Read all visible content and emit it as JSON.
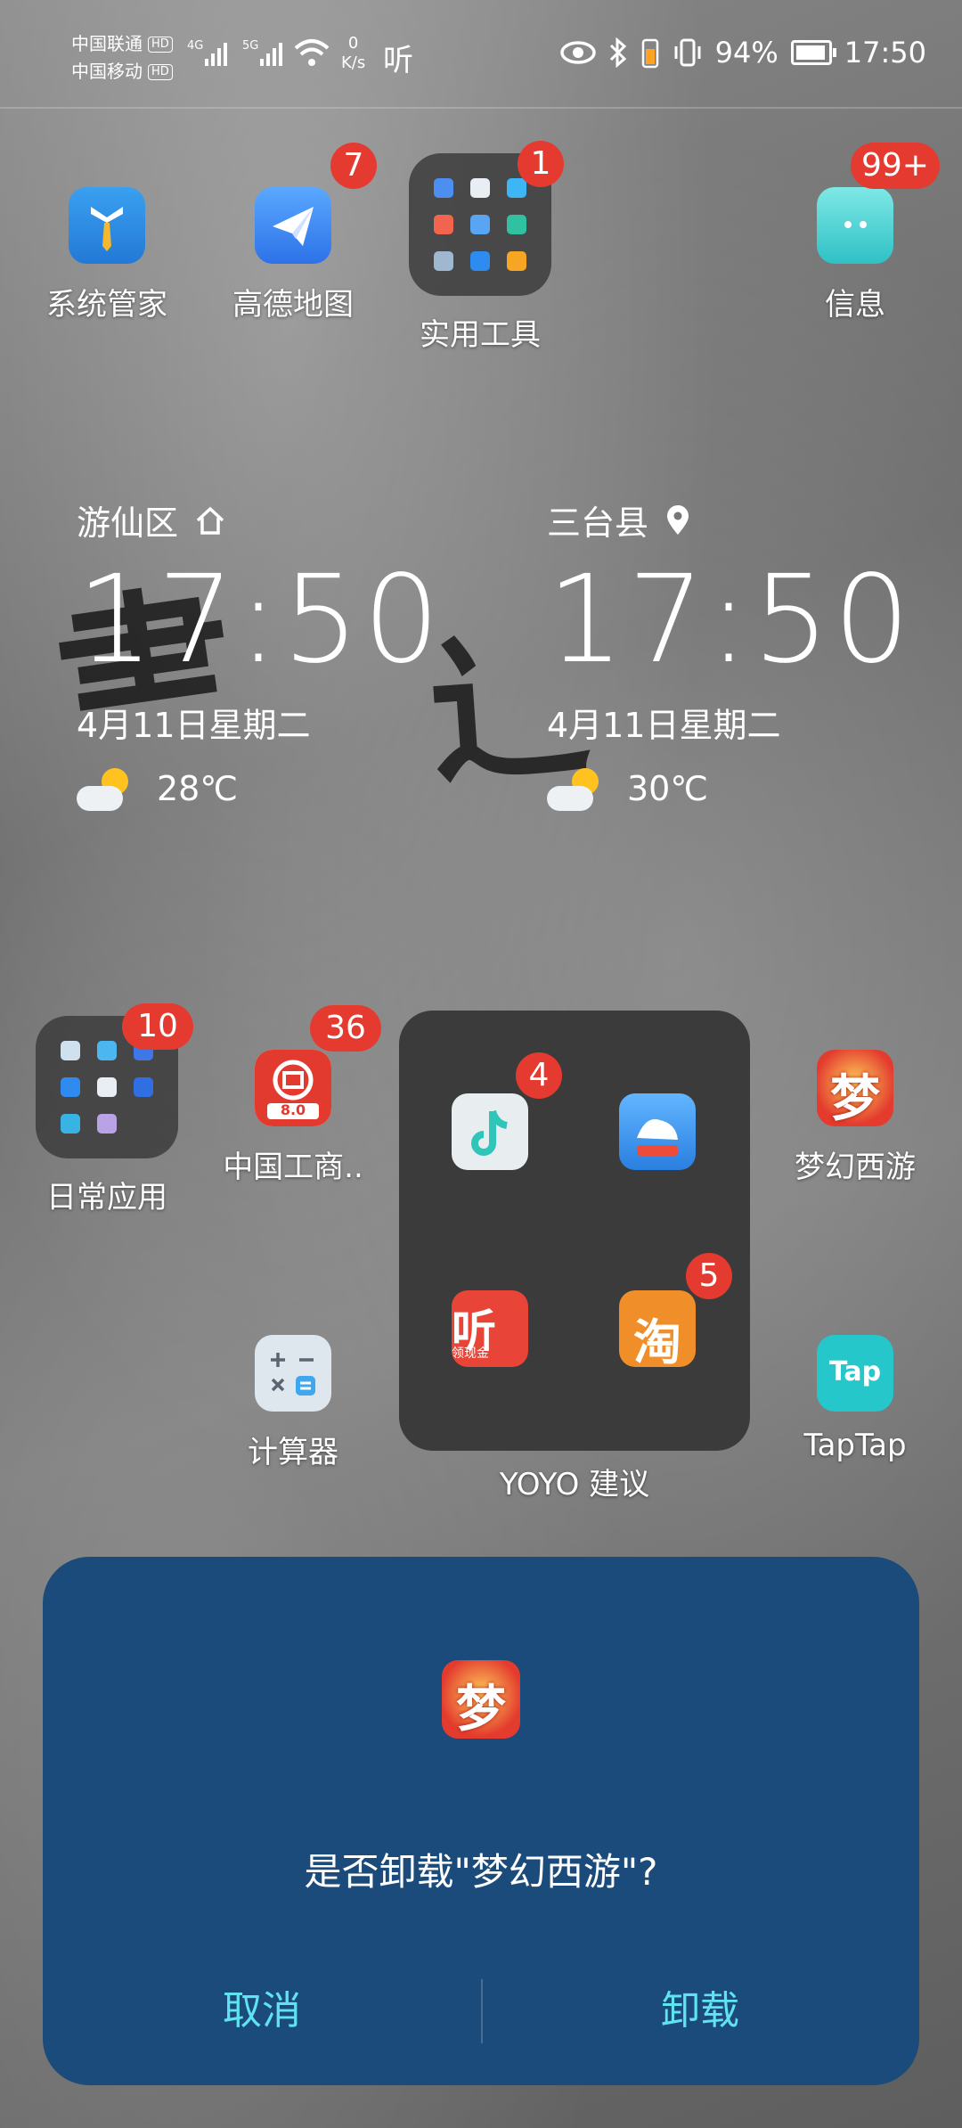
{
  "status_bar": {
    "carrier_1": "中国联通",
    "carrier_2": "中国移动",
    "hd": "HD",
    "net_1": "4G",
    "net_2": "5G",
    "speed_value": "0",
    "speed_unit": "K/s",
    "ting": "听",
    "battery": "94%",
    "time": "17:50"
  },
  "top_row": [
    {
      "label": "系统管家",
      "badge": "",
      "icon": "butler-icon"
    },
    {
      "label": "高德地图",
      "badge": "7",
      "icon": "paper-plane-icon"
    },
    {
      "label": "实用工具",
      "badge": "1",
      "icon": "folder-icon"
    },
    {
      "label": "信息",
      "badge": "99+",
      "icon": "message-icon"
    }
  ],
  "clocks": [
    {
      "location": "游仙区",
      "loc_icon": "home-icon",
      "time": "17:50",
      "date": "4月11日星期二",
      "weather_icon": "partly-cloudy-icon",
      "temp": "28℃"
    },
    {
      "location": "三台县",
      "loc_icon": "location-pin-icon",
      "time": "17:50",
      "date": "4月11日星期二",
      "weather_icon": "partly-cloudy-icon",
      "temp": "30℃"
    }
  ],
  "middle_row": [
    {
      "label": "日常应用",
      "badge": "10",
      "icon": "folder-icon"
    },
    {
      "label": "中国工商..",
      "badge": "36",
      "icon": "icbc-icon",
      "sub": "8.0"
    },
    {
      "label": "梦幻西游",
      "badge": "",
      "icon": "menghuan-icon",
      "glyph": "梦"
    }
  ],
  "yoyo_folder": {
    "label": "YOYO 建议",
    "apps": [
      {
        "icon": "douyin-icon",
        "badge": "4"
      },
      {
        "icon": "blue-app-icon",
        "badge": ""
      },
      {
        "icon": "ting-icon",
        "badge": "",
        "glyph": "听",
        "sub": "领现金"
      },
      {
        "icon": "taobao-icon",
        "badge": "5",
        "glyph": "淘"
      }
    ]
  },
  "bottom_row": [
    {
      "label": "计算器",
      "icon": "calculator-icon"
    },
    {
      "label": "TapTap",
      "icon": "taptap-icon",
      "glyph": "Tap"
    }
  ],
  "dialog": {
    "message": "是否卸载\"梦幻西游\"?",
    "cancel": "取消",
    "confirm": "卸载",
    "glyph": "梦"
  }
}
